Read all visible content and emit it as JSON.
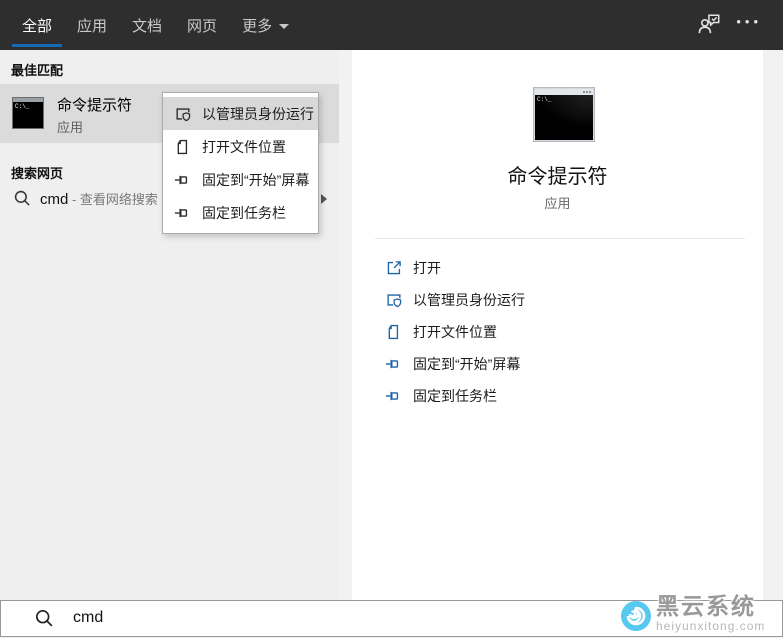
{
  "colors": {
    "topbar_bg": "#2e2e2e",
    "accent_underline": "#1669b4",
    "action_icon_blue": "#1d64a8",
    "left_panel_bg": "#efefef",
    "selected_row_bg": "#dbdbdb",
    "menu_highlight": "#d8d8d8",
    "watermark_blue": "#57c8f0"
  },
  "topbar": {
    "tabs": [
      {
        "label": "全部",
        "active": true
      },
      {
        "label": "应用",
        "active": false
      },
      {
        "label": "文档",
        "active": false
      },
      {
        "label": "网页",
        "active": false
      }
    ],
    "more_label": "更多",
    "icons": [
      {
        "name": "feedback-icon"
      },
      {
        "name": "ellipsis-icon",
        "glyph": "•••"
      }
    ]
  },
  "left": {
    "best_match_header": "最佳匹配",
    "best_match": {
      "title": "命令提示符",
      "subtitle": "应用"
    },
    "web_header": "搜索网页",
    "web_item": {
      "query": "cmd",
      "suffix": " - 查看网络搜索"
    }
  },
  "context_menu": {
    "items": [
      {
        "label": "以管理员身份运行",
        "icon": "run-as-admin-icon",
        "highlighted": true
      },
      {
        "label": "打开文件位置",
        "icon": "open-file-location-icon",
        "highlighted": false
      },
      {
        "label": "固定到“开始”屏幕",
        "icon": "pin-to-start-icon",
        "highlighted": false
      },
      {
        "label": "固定到任务栏",
        "icon": "pin-to-taskbar-icon",
        "highlighted": false
      }
    ]
  },
  "right_panel": {
    "app_title": "命令提示符",
    "app_subtitle": "应用",
    "terminal_prompt": "C:\\_",
    "actions": [
      {
        "label": "打开",
        "icon": "open-icon"
      },
      {
        "label": "以管理员身份运行",
        "icon": "run-as-admin-icon"
      },
      {
        "label": "打开文件位置",
        "icon": "open-file-location-icon"
      },
      {
        "label": "固定到“开始”屏幕",
        "icon": "pin-to-start-icon"
      },
      {
        "label": "固定到任务栏",
        "icon": "pin-to-taskbar-icon"
      }
    ]
  },
  "searchbar": {
    "value": "cmd"
  },
  "watermark": {
    "title": "黑云系统",
    "domain": "heiyunxitong.com"
  }
}
